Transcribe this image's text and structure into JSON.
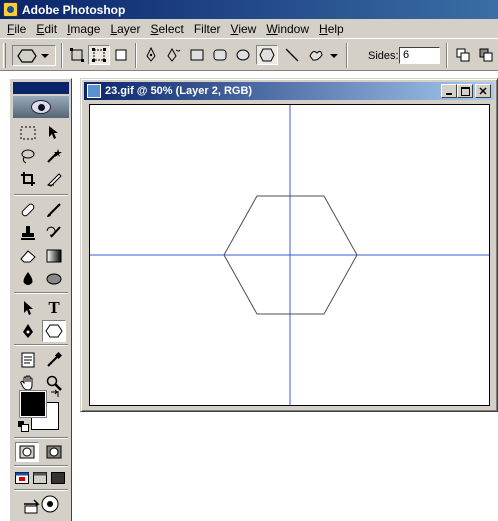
{
  "app": {
    "title": "Adobe Photoshop"
  },
  "menu": [
    {
      "label": "File",
      "key": "F",
      "rest": "ile"
    },
    {
      "label": "Edit",
      "key": "E",
      "rest": "dit"
    },
    {
      "label": "Image",
      "key": "I",
      "rest": "mage"
    },
    {
      "label": "Layer",
      "key": "L",
      "rest": "ayer"
    },
    {
      "label": "Select",
      "key": "S",
      "rest": "elect"
    },
    {
      "label": "Filter",
      "key": "",
      "rest": ""
    },
    {
      "label": "View",
      "key": "V",
      "rest": "iew"
    },
    {
      "label": "Window",
      "key": "W",
      "rest": "indow"
    },
    {
      "label": "Help",
      "key": "H",
      "rest": "elp"
    }
  ],
  "options": {
    "sides_label": "Sides:",
    "sides_value": "6"
  },
  "document": {
    "title": "23.gif @ 50% (Layer 2, RGB)",
    "guide_color": "#3a5bd9",
    "shape_color": "#4f4f4f"
  },
  "toolbox": {
    "foreground_color": "#000000",
    "background_color": "#ffffff",
    "type_tool_glyph": "T"
  }
}
